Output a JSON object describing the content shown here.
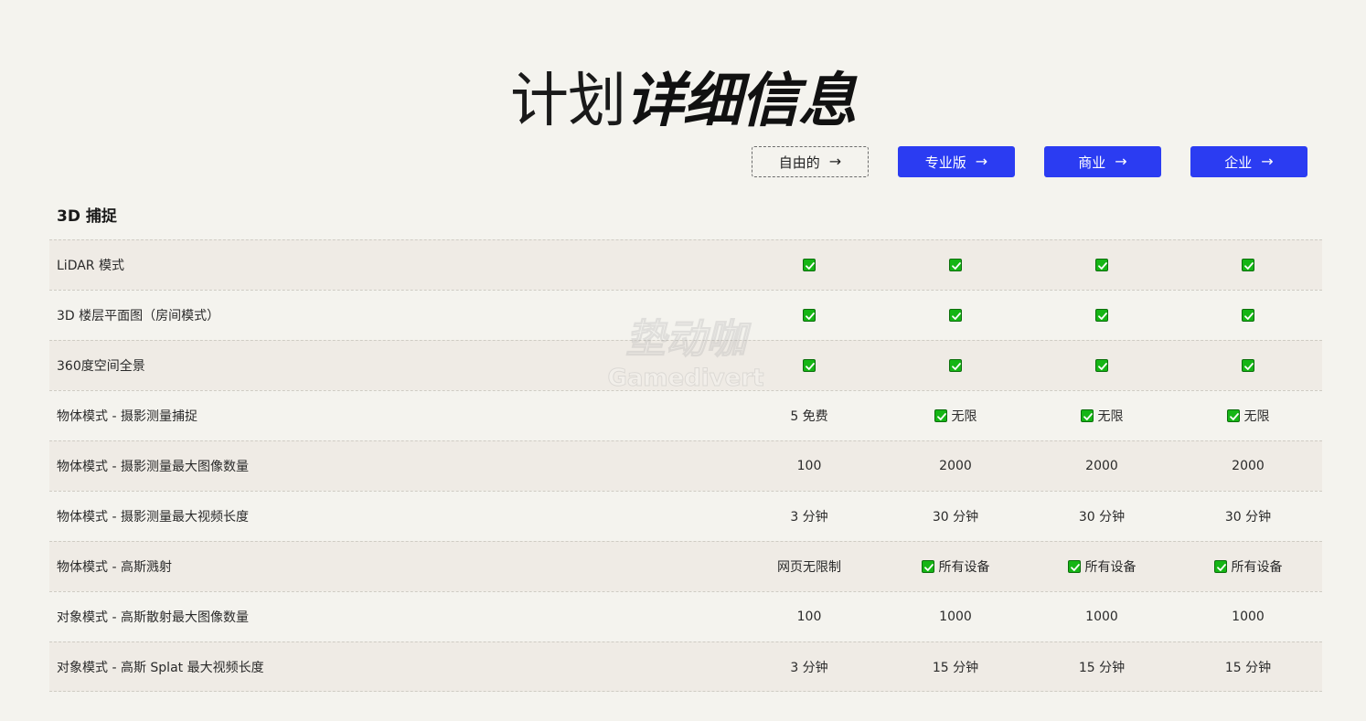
{
  "header": {
    "title_light": "计划",
    "title_bold": "详细信息"
  },
  "plans": [
    {
      "label": "自由的",
      "arrow": "→",
      "style": "outline"
    },
    {
      "label": "专业版",
      "arrow": "→",
      "style": "solid"
    },
    {
      "label": "商业",
      "arrow": "→",
      "style": "solid"
    },
    {
      "label": "企业",
      "arrow": "→",
      "style": "solid"
    }
  ],
  "colors": {
    "accent": "#2b3cf2",
    "check": "#15b515",
    "background": "#f4f3ee",
    "row_alt": "#efebe5"
  },
  "section": {
    "title": "3D 捕捉"
  },
  "rows": [
    {
      "feature": "LiDAR 模式",
      "cells": [
        {
          "check": true,
          "text": ""
        },
        {
          "check": true,
          "text": ""
        },
        {
          "check": true,
          "text": ""
        },
        {
          "check": true,
          "text": ""
        }
      ]
    },
    {
      "feature": "3D 楼层平面图（房间模式）",
      "cells": [
        {
          "check": true,
          "text": ""
        },
        {
          "check": true,
          "text": ""
        },
        {
          "check": true,
          "text": ""
        },
        {
          "check": true,
          "text": ""
        }
      ]
    },
    {
      "feature": "360度空间全景",
      "cells": [
        {
          "check": true,
          "text": ""
        },
        {
          "check": true,
          "text": ""
        },
        {
          "check": true,
          "text": ""
        },
        {
          "check": true,
          "text": ""
        }
      ]
    },
    {
      "feature": "物体模式 - 摄影测量捕捉",
      "cells": [
        {
          "check": false,
          "text": "5 免费"
        },
        {
          "check": true,
          "text": "无限"
        },
        {
          "check": true,
          "text": "无限"
        },
        {
          "check": true,
          "text": "无限"
        }
      ]
    },
    {
      "feature": "物体模式 - 摄影测量最大图像数量",
      "cells": [
        {
          "check": false,
          "text": "100"
        },
        {
          "check": false,
          "text": "2000"
        },
        {
          "check": false,
          "text": "2000"
        },
        {
          "check": false,
          "text": "2000"
        }
      ]
    },
    {
      "feature": "物体模式 - 摄影测量最大视频长度",
      "cells": [
        {
          "check": false,
          "text": "3 分钟"
        },
        {
          "check": false,
          "text": "30 分钟"
        },
        {
          "check": false,
          "text": "30 分钟"
        },
        {
          "check": false,
          "text": "30 分钟"
        }
      ]
    },
    {
      "feature": "物体模式 - 高斯溅射",
      "cells": [
        {
          "check": false,
          "text": "网页无限制"
        },
        {
          "check": true,
          "text": "所有设备"
        },
        {
          "check": true,
          "text": "所有设备"
        },
        {
          "check": true,
          "text": "所有设备"
        }
      ]
    },
    {
      "feature": "对象模式 - 高斯散射最大图像数量",
      "cells": [
        {
          "check": false,
          "text": "100"
        },
        {
          "check": false,
          "text": "1000"
        },
        {
          "check": false,
          "text": "1000"
        },
        {
          "check": false,
          "text": "1000"
        }
      ]
    },
    {
      "feature": "对象模式 - 高斯 Splat 最大视频长度",
      "cells": [
        {
          "check": false,
          "text": "3 分钟"
        },
        {
          "check": false,
          "text": "15 分钟"
        },
        {
          "check": false,
          "text": "15 分钟"
        },
        {
          "check": false,
          "text": "15 分钟"
        }
      ]
    }
  ],
  "watermark": {
    "line1": "垫动咖",
    "line2": "Gamedivert"
  }
}
